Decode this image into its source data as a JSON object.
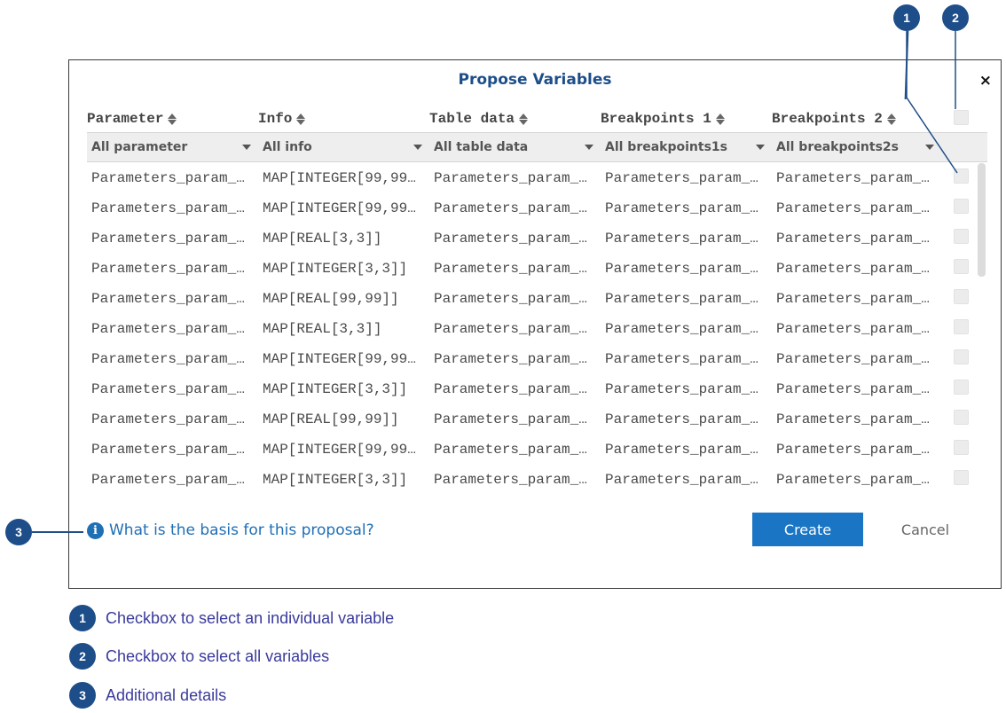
{
  "dialog": {
    "title": "Propose Variables",
    "close_label": "×",
    "columns": [
      {
        "label": "Parameter",
        "filter": "All parameter"
      },
      {
        "label": "Info",
        "filter": "All info"
      },
      {
        "label": "Table data",
        "filter": "All table data"
      },
      {
        "label": "Breakpoints 1",
        "filter": "All breakpoints1s"
      },
      {
        "label": "Breakpoints 2",
        "filter": "All breakpoints2s"
      }
    ],
    "rows": [
      [
        "Parameters_param_…",
        "MAP[INTEGER[99,99…",
        "Parameters_param_…",
        "Parameters_param_…",
        "Parameters_param_…"
      ],
      [
        "Parameters_param_…",
        "MAP[INTEGER[99,99…",
        "Parameters_param_…",
        "Parameters_param_…",
        "Parameters_param_…"
      ],
      [
        "Parameters_param_…",
        "MAP[REAL[3,3]]",
        "Parameters_param_…",
        "Parameters_param_…",
        "Parameters_param_…"
      ],
      [
        "Parameters_param_…",
        "MAP[INTEGER[3,3]]",
        "Parameters_param_…",
        "Parameters_param_…",
        "Parameters_param_…"
      ],
      [
        "Parameters_param_…",
        "MAP[REAL[99,99]]",
        "Parameters_param_…",
        "Parameters_param_…",
        "Parameters_param_…"
      ],
      [
        "Parameters_param_…",
        "MAP[REAL[3,3]]",
        "Parameters_param_…",
        "Parameters_param_…",
        "Parameters_param_…"
      ],
      [
        "Parameters_param_…",
        "MAP[INTEGER[99,99…",
        "Parameters_param_…",
        "Parameters_param_…",
        "Parameters_param_…"
      ],
      [
        "Parameters_param_…",
        "MAP[INTEGER[3,3]]",
        "Parameters_param_…",
        "Parameters_param_…",
        "Parameters_param_…"
      ],
      [
        "Parameters_param_…",
        "MAP[REAL[99,99]]",
        "Parameters_param_…",
        "Parameters_param_…",
        "Parameters_param_…"
      ],
      [
        "Parameters_param_…",
        "MAP[INTEGER[99,99…",
        "Parameters_param_…",
        "Parameters_param_…",
        "Parameters_param_…"
      ],
      [
        "Parameters_param_…",
        "MAP[INTEGER[3,3]]",
        "Parameters_param_…",
        "Parameters_param_…",
        "Parameters_param_…"
      ]
    ],
    "info_link": "What is the basis for this proposal?",
    "create_label": "Create",
    "cancel_label": "Cancel"
  },
  "callouts": {
    "one": "1",
    "two": "2",
    "three": "3"
  },
  "legend": [
    {
      "num": "1",
      "text": "Checkbox to select an individual variable"
    },
    {
      "num": "2",
      "text": "Checkbox to select all variables"
    },
    {
      "num": "3",
      "text": "Additional details"
    }
  ],
  "colors": {
    "accent": "#1d4e89",
    "button": "#1a75c4",
    "link": "#1f6fb5",
    "legend_text": "#3a3a9c"
  }
}
